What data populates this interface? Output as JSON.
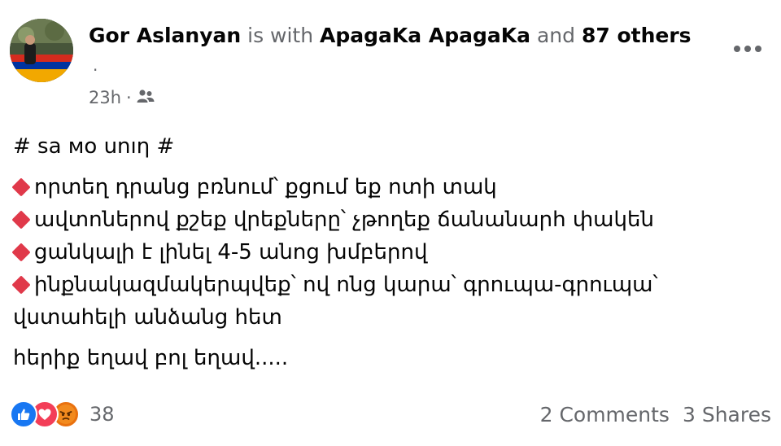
{
  "post": {
    "author": "Gor Aslanyan",
    "is_with": "is with",
    "tagged": "ApagaKa ApagaKa",
    "and": "and",
    "others": "87 others",
    "dot": ".",
    "time": "23h",
    "separator": "·",
    "audience_icon": "friends-icon",
    "hashtag": "# sa мо unıη #",
    "bullets": [
      "որտեղ դրանց բռնում՝  քցում եք ոտի տակ",
      "ավտոներով քշեք վրեքները՝ չթողեք ճանանարհ փակեն",
      "ցանկալի է լինել 4-5 անոց խմբերով",
      "ինքնակազմակերպվեք՝ ով ոնց կարա՝ գրուպա-գրուպա՝"
    ],
    "bullet_continuation": "վստահելի անձանց հետ",
    "closing": "հերիք եղավ բոլ եղավ....."
  },
  "footer": {
    "reaction_icons": [
      "like-icon",
      "love-icon",
      "angry-icon"
    ],
    "reaction_count": "38",
    "comments": "2 Comments",
    "shares": "3 Shares"
  },
  "colors": {
    "primary_text": "#050505",
    "secondary_text": "#65676b",
    "bullet_diamond": "#e0394a",
    "like": "#1877f2",
    "love": "#f33e58",
    "angry": "#e9710f"
  }
}
